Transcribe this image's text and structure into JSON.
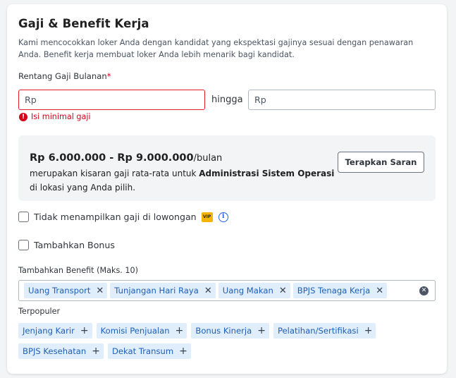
{
  "section": {
    "title": "Gaji & Benefit Kerja",
    "description": "Kami mencocokkan loker Anda dengan kandidat yang ekspektasi gajinya sesuai dengan penawaran Anda. Benefit kerja membuat loker Anda lebih menarik bagi kandidat."
  },
  "salary": {
    "label": "Rentang Gaji Bulanan",
    "required_mark": "*",
    "min_placeholder": "Rp",
    "separator": "hingga",
    "max_placeholder": "Rp",
    "error": "Isi minimal gaji"
  },
  "suggestion": {
    "range": "Rp 6.000.000 - Rp 9.000.000",
    "unit": "/bulan",
    "text_prefix": "merupakan kisaran gaji rata-rata untuk ",
    "job_title": "Administrasi Sistem Operasi",
    "text_suffix": "di lokasi yang Anda pilih.",
    "apply_button": "Terapkan Saran"
  },
  "options": {
    "hide_salary": "Tidak menampilkan gaji di lowongan",
    "vip_badge": "VIP",
    "add_bonus": "Tambahkan Bonus"
  },
  "benefits": {
    "label": "Tambahkan Benefit (Maks. 10)",
    "selected": [
      "Uang Transport",
      "Tunjangan Hari Raya",
      "Uang Makan",
      "BPJS Tenaga Kerja"
    ],
    "popular_label": "Terpopuler",
    "popular": [
      "Jenjang Karir",
      "Komisi Penjualan",
      "Bonus Kinerja",
      "Pelatihan/Sertifikasi",
      "BPJS Kesehatan",
      "Dekat Transum"
    ]
  },
  "icons": {
    "error": "error-icon",
    "info": "info-icon",
    "remove": "close-icon",
    "add": "plus-icon",
    "clear": "clear-icon"
  },
  "colors": {
    "accent": "#1d5fb8",
    "error": "#d6001c",
    "chip_bg": "#e0edfb",
    "vip": "#f5b400"
  }
}
